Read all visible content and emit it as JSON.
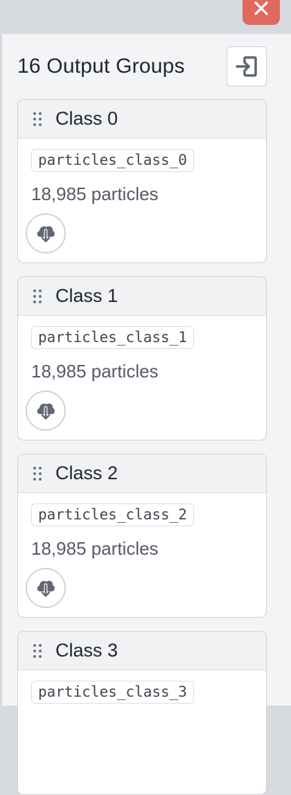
{
  "panel": {
    "title": "16 Output Groups",
    "close_icon": "close-icon",
    "export_icon": "sign-in-icon"
  },
  "groups": [
    {
      "title": "Class 0",
      "name": "particles_class_0",
      "count": "18,985 particles"
    },
    {
      "title": "Class 1",
      "name": "particles_class_1",
      "count": "18,985 particles"
    },
    {
      "title": "Class 2",
      "name": "particles_class_2",
      "count": "18,985 particles"
    },
    {
      "title": "Class 3",
      "name": "particles_class_3",
      "count": ""
    }
  ],
  "colors": {
    "close_bg": "#e06a5f",
    "icon_gray": "#606770",
    "panel_bg": "#f3f4f6"
  }
}
